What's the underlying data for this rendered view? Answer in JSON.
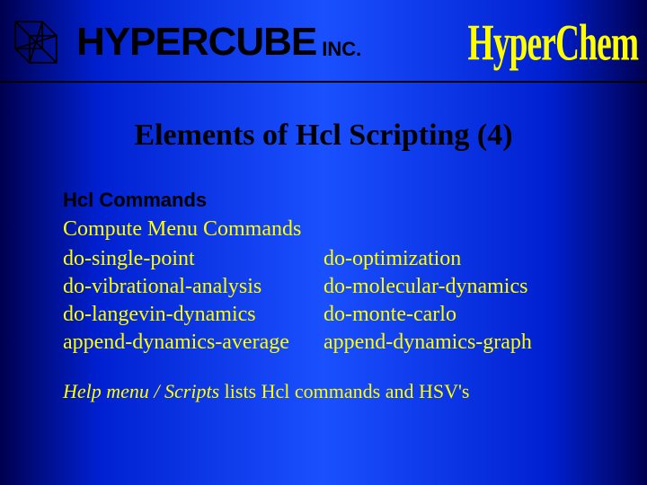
{
  "header": {
    "company": "HYPERCUBE",
    "company_suffix": "INC.",
    "product": "HyperChem"
  },
  "title": "Elements of Hcl Scripting (4)",
  "section_heading": "Hcl Commands",
  "subheading": "Compute Menu Commands",
  "commands": {
    "r1": {
      "l": "do-single-point",
      "r": "do-optimization"
    },
    "r2": {
      "l": "do-vibrational-analysis",
      "r": "do-molecular-dynamics"
    },
    "r3": {
      "l": "do-langevin-dynamics",
      "r": "do-monte-carlo"
    },
    "r4": {
      "l": "append-dynamics-average",
      "r": "append-dynamics-graph"
    }
  },
  "footnote": {
    "italic": "Help menu / Scripts",
    "rest": " lists Hcl commands and HSV's"
  }
}
